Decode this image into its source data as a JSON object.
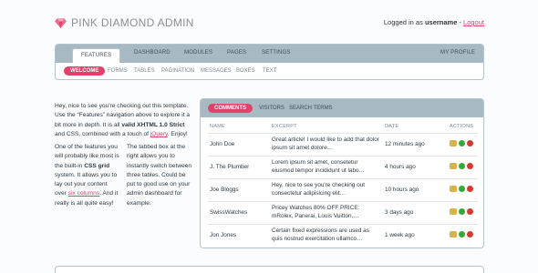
{
  "header": {
    "title": "PINK DIAMOND ADMIN",
    "logged_in_text": "Logged in as",
    "username": "username",
    "separator": " - ",
    "logout_label": "Logout"
  },
  "nav": {
    "tabs": [
      "FEATURES",
      "DASHBOARD",
      "MODULES",
      "PAGES",
      "SETTINGS"
    ],
    "profile_label": "MY PROFILE",
    "subnav": [
      "WELCOME",
      "FORMS",
      "TABLES",
      "PAGINATION",
      "MESSAGES",
      "BOXES",
      "TEXT"
    ]
  },
  "intro": {
    "p1_a": "Hey, nice to see you're checking out this template. Use the “Features” navigation above to explore it a bit more in depth. It is all ",
    "p1_b": "valid XHTML 1.0 Strict",
    "p1_c": " and CSS, combined with a touch of ",
    "p1_link": "jQuery",
    "p1_d": ". Enjoy!",
    "c1_a": "One of the features you will probably like most is the built-in ",
    "c1_b": "CSS grid",
    "c1_c": " system. It allows you to lay out your content over ",
    "c1_link": "six columns",
    "c1_d": ". And it really is all quite easy!",
    "c2": "The tabbed box at the right allows you to instantly switch between three tables. Could be put to good use on your admin dashboard for example."
  },
  "panel": {
    "tabs": [
      "COMMENTS",
      "VISITORS",
      "SEARCH TERMS"
    ],
    "columns": [
      "NAME",
      "EXCERPT",
      "DATE",
      "ACTIONS"
    ],
    "rows": [
      {
        "name": "John Doe",
        "excerpt": "Great article! I would like to add that dolor ipsum sit amet dolore…",
        "date": "12 minutes ago"
      },
      {
        "name": "J. The Plumber",
        "excerpt": "Lorem ipsum sit amet, consetetur eiusmod tempor incididunt ut labo…",
        "date": "4 hours ago"
      },
      {
        "name": "Joe Bloggs",
        "excerpt": "Hey, nice to see you're checking out consectetur adipisicing elit…",
        "date": "10 hours ago"
      },
      {
        "name": "SwissWatches",
        "excerpt": "Pricey Watches 80% OFF PRICE: mRolex, Panerai, Louis Vuitton,…",
        "date": "3 days ago"
      },
      {
        "name": "Jon Jones",
        "excerpt": "Certain fixed expressions are used as quis nostrud exercitation ullamco…",
        "date": "1 week ago"
      }
    ]
  },
  "colors": {
    "accent": "#e2416a",
    "nav_bg": "#a7b9c3",
    "border": "#b5c4cc"
  }
}
